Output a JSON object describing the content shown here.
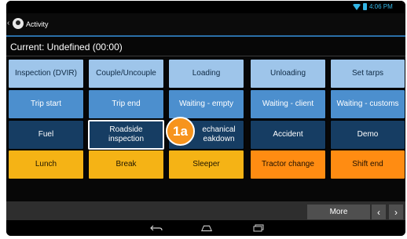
{
  "status_bar": {
    "time": "4:06 PM",
    "icons": [
      "wifi-icon",
      "battery-icon"
    ],
    "accent": "#33b5e5"
  },
  "action_bar": {
    "back_glyph": "‹",
    "title": "Activity",
    "icon": "app-logo-icon"
  },
  "current_status": "Current: Undefined (00:00)",
  "activity_rows": [
    [
      "Inspection (DVIR)",
      "Couple/Uncouple",
      "Loading",
      "Unloading",
      "Set tarps"
    ],
    [
      "Trip start",
      "Trip end",
      "Waiting - empty",
      "Waiting - client",
      "Waiting - customs"
    ],
    [
      "Fuel",
      "Roadside inspection",
      "Mechanical breakdown",
      "Accident",
      "Demo"
    ],
    [
      "Lunch",
      "Break",
      "Sleeper",
      "Tractor change",
      "Shift end"
    ]
  ],
  "mechanical_visible": [
    "echanical",
    "eakdown"
  ],
  "selected_button": "Roadside inspection",
  "callout_label": "1a",
  "bottom_bar": {
    "more_label": "More",
    "prev_glyph": "‹",
    "next_glyph": "›"
  },
  "nav_bar": {
    "back_icon": "back-icon",
    "home_icon": "home-icon",
    "recents_icon": "recents-icon"
  },
  "colors": {
    "row1": "#9ec5ea",
    "row2": "#4c8fce",
    "row3": "#163d63",
    "row4_yellow": "#f5b315",
    "row4_orange": "#ff8c12",
    "callout": "#f7941d",
    "actionbar_underline": "#2b6fa8"
  }
}
